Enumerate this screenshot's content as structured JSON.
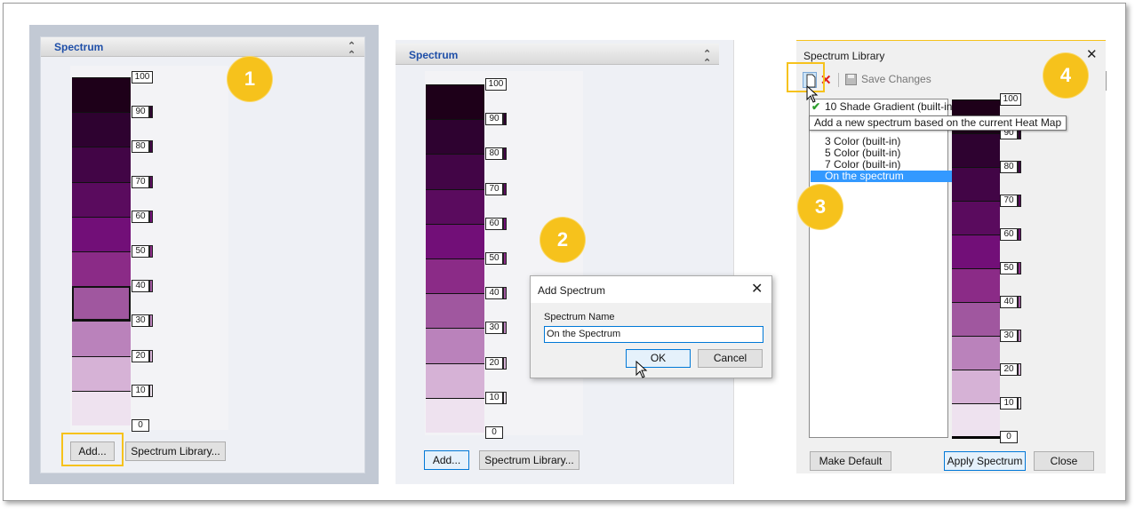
{
  "colors": {
    "shades": [
      "#1e0019",
      "#2e0230",
      "#420546",
      "#5a0b5e",
      "#720f78",
      "#8b2b87",
      "#a0579f",
      "#ba82bb",
      "#d6b2d6",
      "#eee2ef"
    ],
    "shades_panel3": [
      "#1e0019",
      "#2e0230",
      "#420546",
      "#5a0b5e",
      "#720f78",
      "#8b2b87",
      "#a0579f",
      "#ba82bb",
      "#d6b2d6",
      "#eee2ef"
    ],
    "accent": "#f6c21c",
    "title_blue": "#1f4fa8",
    "selection": "#3399ff"
  },
  "scale_labels": [
    "100",
    "90",
    "80",
    "70",
    "60",
    "50",
    "40",
    "30",
    "20",
    "10",
    "0"
  ],
  "panel1": {
    "title": "Spectrum",
    "add_label": "Add...",
    "library_label": "Spectrum Library...",
    "step": "1"
  },
  "panel2": {
    "title": "Spectrum",
    "add_label": "Add...",
    "library_label": "Spectrum Library...",
    "step": "2",
    "dialog": {
      "title": "Add Spectrum",
      "field_label": "Spectrum Name",
      "field_value": "On the Spectrum",
      "ok_label": "OK",
      "cancel_label": "Cancel"
    }
  },
  "panel3": {
    "title": "Spectrum Library",
    "save_label": "Save Changes",
    "tooltip": "Add a new spectrum based on the current Heat Map",
    "step_left": "3",
    "step_right": "4",
    "list": [
      {
        "label": "10 Shade Gradient (built-in)",
        "checked": true,
        "selected": false
      },
      {
        "label": "3 Color (built-in)",
        "checked": false,
        "selected": false
      },
      {
        "label": "5 Color (built-in)",
        "checked": false,
        "selected": false
      },
      {
        "label": "7 Color (built-in)",
        "checked": false,
        "selected": false
      },
      {
        "label": "On the spectrum",
        "checked": false,
        "selected": true
      }
    ],
    "make_default_label": "Make Default",
    "apply_label": "Apply Spectrum",
    "close_label": "Close"
  }
}
